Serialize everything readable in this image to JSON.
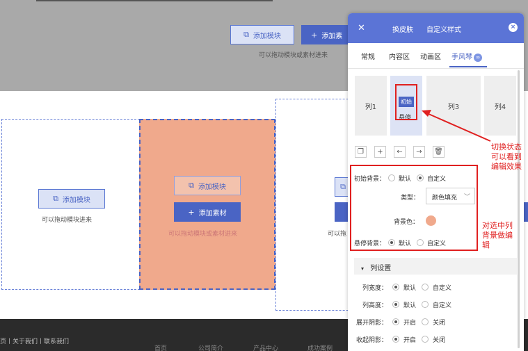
{
  "canvas": {
    "top_add_module": "添加模块",
    "top_add_material": "添加素",
    "top_hint": "可以拖动模块或素材进来",
    "col1_add_module": "添加模块",
    "col1_hint": "可以拖动模块进来",
    "col2_add_module": "添加模块",
    "col2_add_material": "添加素材",
    "col2_hint": "可以拖动模块或素材进来",
    "col3_add_module": "添",
    "col3_hint": "可以拖",
    "footer_links": "页丨关于我们丨联系我们",
    "footer_nav": [
      "首页",
      "公司简介",
      "产品中心",
      "成功案例"
    ]
  },
  "panel": {
    "tabs": [
      "换皮肤",
      "自定义样式"
    ],
    "close": "×",
    "subtabs": [
      "常规",
      "内容区",
      "动画区",
      "手风琴"
    ],
    "columns": [
      "列1",
      "列3",
      "列4"
    ],
    "state_initial": "初始",
    "state_hover": "悬停",
    "toolbar": [
      "copy",
      "add",
      "left",
      "right",
      "delete"
    ],
    "init_bg_label": "初始背景：",
    "init_bg_options": [
      "默认",
      "自定义"
    ],
    "type_label": "类型：",
    "type_value": "颜色填充",
    "bg_color_label": "背景色：",
    "bg_color": "#f0a98c",
    "hover_bg_label": "悬停背景：",
    "hover_bg_options": [
      "默认",
      "自定义"
    ],
    "section_title": "列设置",
    "col_width_label": "列宽度：",
    "col_height_label": "列高度：",
    "expand_shadow_label": "展开阴影：",
    "collapse_shadow_label": "收起阴影：",
    "opt_default": "默认",
    "opt_custom": "自定义",
    "opt_on": "开启",
    "opt_off": "关闭"
  },
  "annotations": {
    "note1": [
      "切换状态",
      "可以看到",
      "编辑效果"
    ],
    "note2": [
      "对选中列",
      "背景做编",
      "辑"
    ]
  },
  "colors": {
    "accent": "#4a64c4",
    "panel_header": "#5b74d6",
    "selected_column": "#f0a98c",
    "annotation": "#e02020"
  }
}
